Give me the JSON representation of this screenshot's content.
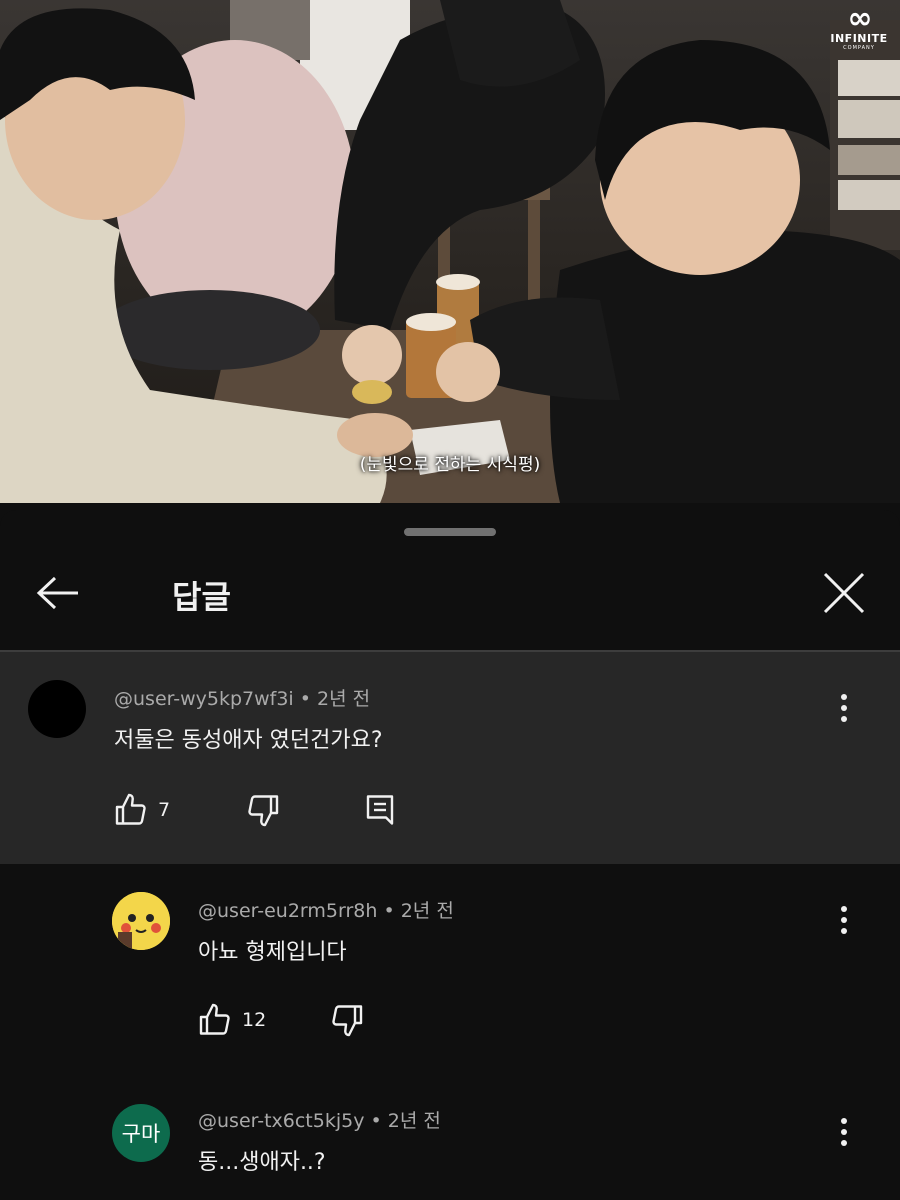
{
  "video": {
    "subtitle": "(눈빛으로 전하는 시식평)",
    "logo": {
      "mark": "∞",
      "name": "INFINITE",
      "sub": "COMPANY"
    }
  },
  "header": {
    "title": "답글",
    "back_icon": "arrow-left-icon",
    "close_icon": "close-icon"
  },
  "parent_comment": {
    "author": "@user-wy5kp7wf3i",
    "time": "2년 전",
    "text": "저둘은 동성애자 였던건가요?",
    "likes": "7",
    "avatar_color": "#000000"
  },
  "replies": [
    {
      "author": "@user-eu2rm5rr8h",
      "time": "2년 전",
      "text": "아뇨 형제입니다",
      "likes": "12",
      "avatar_icon": "pikachu-avatar-icon"
    },
    {
      "author": "@user-tx6ct5kj5y",
      "time": "2년 전",
      "text": "동...생애자..?",
      "avatar_text": "구마",
      "avatar_color": "#0d6b4d"
    }
  ],
  "separator": "•"
}
